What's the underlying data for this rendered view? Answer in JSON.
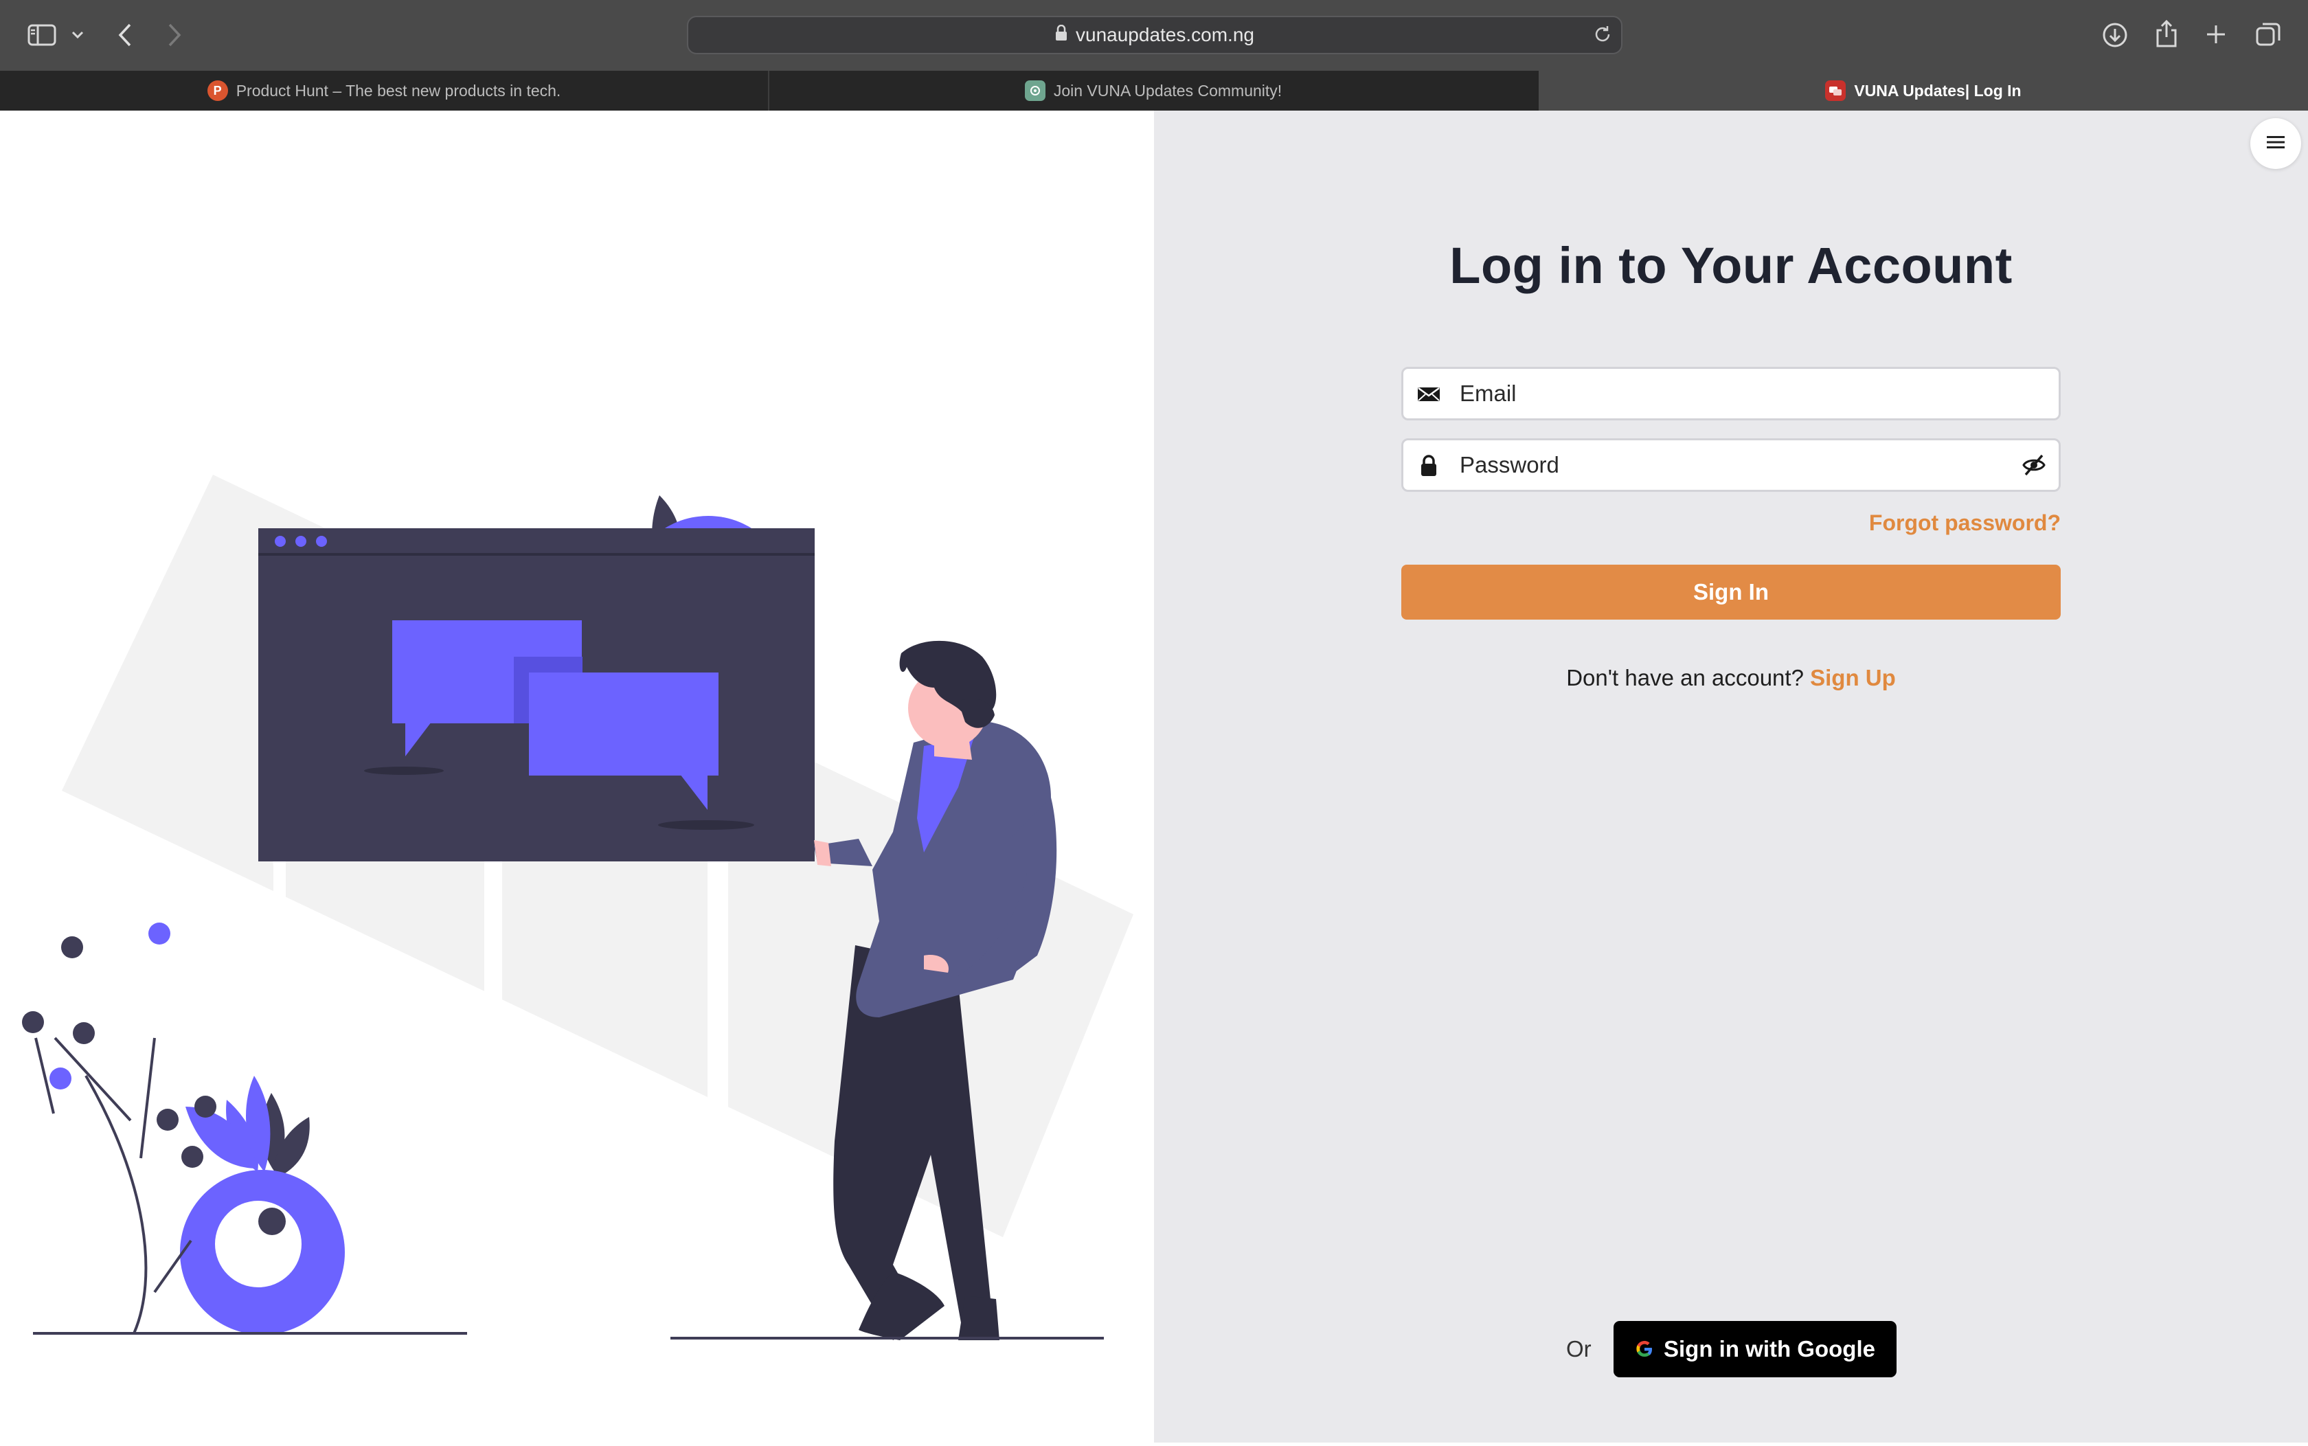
{
  "browser": {
    "url": "vunaupdates.com.ng",
    "tabs": [
      {
        "label": "Product Hunt – The best new products in tech.",
        "favicon_letter": "P",
        "favicon_color": "#da552f",
        "active": false
      },
      {
        "label": "Join VUNA Updates Community!",
        "favicon_letter": "",
        "favicon_color": "#6fa58f",
        "active": false
      },
      {
        "label": "VUNA Updates| Log In",
        "favicon_letter": "",
        "favicon_color": "#c8312c",
        "active": true
      }
    ]
  },
  "login": {
    "title": "Log in to Your Account",
    "email_placeholder": "Email",
    "password_placeholder": "Password",
    "forgot_password": "Forgot password?",
    "sign_in": "Sign In",
    "no_account": "Don't have an account?",
    "sign_up": "Sign Up",
    "or": "Or",
    "google_sign_in": "Sign in with Google"
  },
  "colors": {
    "accent": "#e28b46",
    "right_background": "#e9e9ec",
    "illustration_primary": "#6c63ff",
    "illustration_dark": "#3f3d56"
  }
}
